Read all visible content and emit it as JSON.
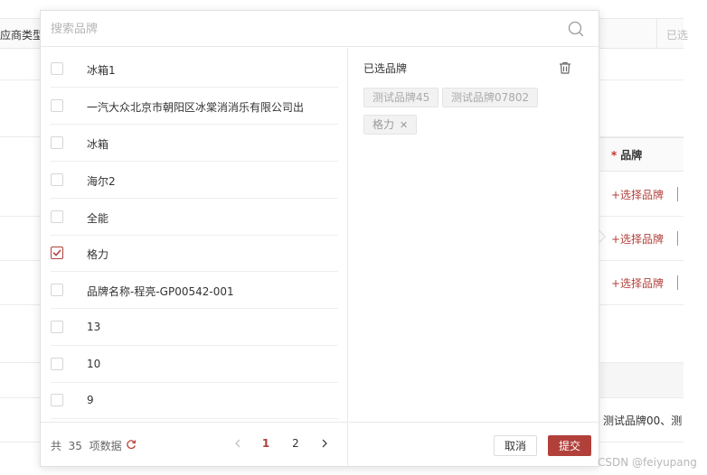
{
  "background": {
    "supplier_type_label": "应商类型",
    "selected_label_partial": "已选",
    "brand_column_required_mark": "*",
    "brand_column_title": "品牌",
    "select_brand_links": [
      "+选择品牌",
      "+选择品牌",
      "+选择品牌"
    ],
    "row_brands_text": "测试品牌00、测"
  },
  "dialog": {
    "search": {
      "placeholder": "搜索品牌",
      "value": ""
    },
    "brand_list": [
      {
        "label": "冰箱1",
        "checked": false
      },
      {
        "label": "一汽大众北京市朝阳区冰棠消消乐有限公司出",
        "checked": false
      },
      {
        "label": "冰箱",
        "checked": false
      },
      {
        "label": "海尔2",
        "checked": false
      },
      {
        "label": "全能",
        "checked": false
      },
      {
        "label": "格力",
        "checked": true
      },
      {
        "label": "品牌名称-程亮-GP00542-001",
        "checked": false
      },
      {
        "label": "13",
        "checked": false
      },
      {
        "label": "10",
        "checked": false
      },
      {
        "label": "9",
        "checked": false
      }
    ],
    "pagination": {
      "total_prefix": "共",
      "total_count": "35",
      "total_suffix": "项数据",
      "pages": [
        "1",
        "2"
      ],
      "current_page": "1"
    },
    "selected_panel": {
      "title": "已选品牌",
      "tags": [
        {
          "label": "测试品牌45",
          "removable": false
        },
        {
          "label": "测试品牌07802",
          "removable": false
        },
        {
          "label": "格力",
          "removable": true
        }
      ]
    },
    "buttons": {
      "cancel": "取消",
      "submit": "提交"
    }
  },
  "watermark": "CSDN @feiyupang",
  "colors": {
    "accent": "#b2403a",
    "border": "#e8e8e8",
    "tag_bg": "#f2f2f2"
  },
  "icons": [
    "search-icon",
    "refresh-icon",
    "chevron-left-icon",
    "chevron-right-icon",
    "trash-icon",
    "checkmark-icon",
    "close-icon"
  ]
}
